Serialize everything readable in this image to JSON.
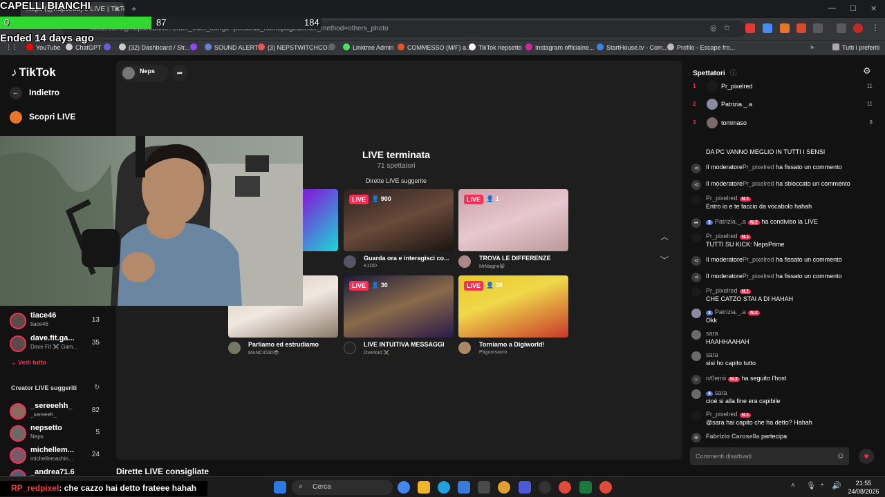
{
  "browser": {
    "tab_title": "Neps (@nepsetto) è LIVE | TikTok",
    "url_prefix": "tiktok.com/",
    "url": "@nepsetto/live?enter_from_merge=personal_homepage&enter_method=others_photo",
    "new_tab": "+",
    "close_tab": "✕",
    "window_controls": [
      "—",
      "☐",
      "✕"
    ],
    "bookmarks": [
      {
        "label": "YouTube",
        "color": "#ff0000"
      },
      {
        "label": "ChatGPT",
        "color": "#cfcfcf"
      },
      {
        "label": "",
        "color": "#6e5ce6"
      },
      {
        "label": "(32) Dashboard / Str...",
        "color": "#cccccc"
      },
      {
        "label": "",
        "color": "#9146ff"
      },
      {
        "label": "SOUND ALERT",
        "color": "#6a7fd8"
      },
      {
        "label": "(3) NEPSTWITCHCO...",
        "color": "#e55"
      },
      {
        "label": "",
        "color": "#666"
      },
      {
        "label": "Linktree Admin",
        "color": "#43e55e"
      },
      {
        "label": "COMMESSO (M/F) a...",
        "color": "#e8532a"
      },
      {
        "label": "TikTok nepsetto",
        "color": "#ffffff"
      },
      {
        "label": "Instagram officialne...",
        "color": "#d6249f"
      },
      {
        "label": "StartHouse.tv - Com...",
        "color": "#3a84f0"
      },
      {
        "label": "Profilo - Escape fro...",
        "color": "#bbbbbb"
      }
    ],
    "bookmarks_more": "»",
    "all_bookmarks": "Tutti i preferiti"
  },
  "overlay": {
    "title": "CAPELLI BIANCHI",
    "poll_left": "0",
    "poll_mid": "87",
    "poll_right": "184",
    "poll_fraction": 0.47,
    "ended": "Ended 14 days ago"
  },
  "nav": {
    "logo": "TikTok",
    "back": "Indietro",
    "discover": "Scopri LIVE",
    "channels": [
      {
        "name": "tiace46",
        "sub": "tiace46",
        "count": "13"
      },
      {
        "name": "dave.fit.ga...",
        "sub": "Dave Fit ⚔️ Gam...",
        "count": "35"
      }
    ],
    "see_all": "Vedi tutto",
    "suggested_title": "Creator LIVE suggeriti",
    "suggested": [
      {
        "name": "_sereeehh_",
        "sub": "_sereeeh_",
        "count": "82"
      },
      {
        "name": "nepsetto",
        "sub": "Neps",
        "count": "5"
      },
      {
        "name": "michellem...",
        "sub": "michellemachin...",
        "count": "24"
      },
      {
        "name": "_andrea71.6",
        "sub": "",
        "count": ""
      }
    ]
  },
  "main": {
    "host": "Neps",
    "ended_title": "LIVE terminata",
    "viewers": "71 spettatori",
    "suggested_title": "Dirette LIVE suggerite",
    "live_label": "LIVE",
    "cards": [
      {
        "viewers": "900",
        "title": "Guarda ora e interagisci co...",
        "user": "K1OD"
      },
      {
        "viewers": "1",
        "title": "TROVA LE DIFFERENZE",
        "user": "MrMagno😸"
      },
      {
        "viewers": "",
        "title": "Parliamo ed estrudiamo",
        "user": "MANCIO3D😎"
      },
      {
        "viewers": "30",
        "title": "LIVE INTUITIVA MESSAGGI",
        "user": "Overlord ⚔️"
      },
      {
        "viewers": "38",
        "title": "Torniamo a Digiworld!",
        "user": "Pagurosauro"
      }
    ],
    "bottom_label": "Dirette LIVE consigliate"
  },
  "right": {
    "title": "Spettatori",
    "ranks": [
      {
        "n": "1",
        "name": "Pr_pixelred",
        "count": "11"
      },
      {
        "n": "2",
        "name": "Patrizia._.a",
        "count": "11"
      },
      {
        "n": "3",
        "name": "tommaso",
        "count": "8"
      }
    ],
    "chat": [
      {
        "user": "",
        "text": "DA PC VANNO MEGLIO IN TUTTI I SENSI"
      },
      {
        "user": "Il moderatore",
        "bold": "Pr_pixelred",
        "text": "ha fissato un commento"
      },
      {
        "user": "Il moderatore",
        "bold": "Pr_pixelred",
        "text": "ha sbloccato un commento"
      },
      {
        "user": "Pr_pixelred",
        "badge": "N.1",
        "text": "Entro io e te faccio da vocabolo hahah"
      },
      {
        "user": "Patrizia._.a",
        "badge": "N.2",
        "lvl": "3",
        "text": "ha condiviso la LIVE"
      },
      {
        "user": "Pr_pixelred",
        "badge": "N.1",
        "text": "TUTTI SU KICK: NepsPrime"
      },
      {
        "user": "Il moderatore",
        "bold": "Pr_pixelred",
        "text": "ha fissato un commento"
      },
      {
        "user": "Il moderatore",
        "bold": "Pr_pixelred",
        "text": "ha fissato un commento"
      },
      {
        "user": "Pr_pixelred",
        "badge": "N.1",
        "text": "CHE CATZO STAI A DI HAHAH"
      },
      {
        "user": "Patrizia._.a",
        "badge": "N.2",
        "lvl": "3",
        "text": "Okk"
      },
      {
        "user": "sara",
        "text": "HAAHHAAHAH"
      },
      {
        "user": "sara",
        "text": "sisi ho capito tutto"
      },
      {
        "user": "n/0emii",
        "badge": "N.3",
        "text": "ha seguito l'host"
      },
      {
        "user": "sara",
        "lvl": "4",
        "text": "cioè si alla fine era capibile"
      },
      {
        "user": "Pr_pixelred",
        "badge": "N.1",
        "text": "@sara hai capito che ha detto? Hahah"
      },
      {
        "user": "Fabrizio Carosella",
        "text": "partecipa"
      }
    ],
    "comment_placeholder": "Commenti disattivati"
  },
  "taskbar": {
    "search": "Cerca",
    "time": "21:55",
    "date": "24/08/2026"
  },
  "chat_overlay": {
    "user": "RP_redpixel",
    "text": ": che cazzo hai detto frateee hahah"
  },
  "colors": {
    "accent": "#fe2c55",
    "poll": "#32d732"
  }
}
